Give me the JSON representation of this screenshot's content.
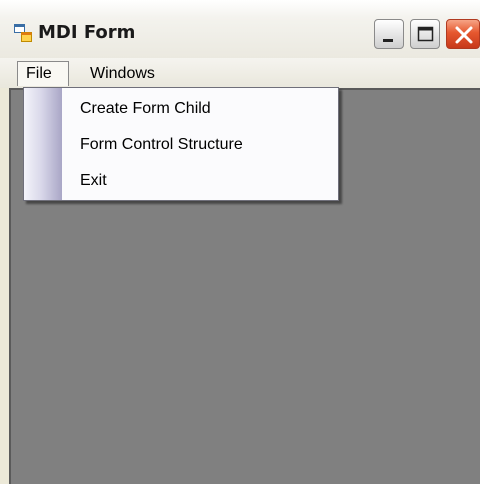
{
  "window": {
    "title": "MDI Form",
    "title_icon": "app-window-icon",
    "buttons": {
      "minimize_icon": "minimize-icon",
      "maximize_icon": "maximize-icon",
      "close_icon": "close-icon"
    }
  },
  "menubar": {
    "items": [
      {
        "label": "File"
      },
      {
        "label": "Windows"
      }
    ]
  },
  "file_menu": {
    "items": [
      {
        "label": "Create Form Child"
      },
      {
        "label": "Form Control Structure"
      },
      {
        "label": "Exit"
      }
    ]
  },
  "colors": {
    "mdi_background": "#808080",
    "close_button": "#e6582f",
    "menu_strip": "#a9a6c6"
  }
}
